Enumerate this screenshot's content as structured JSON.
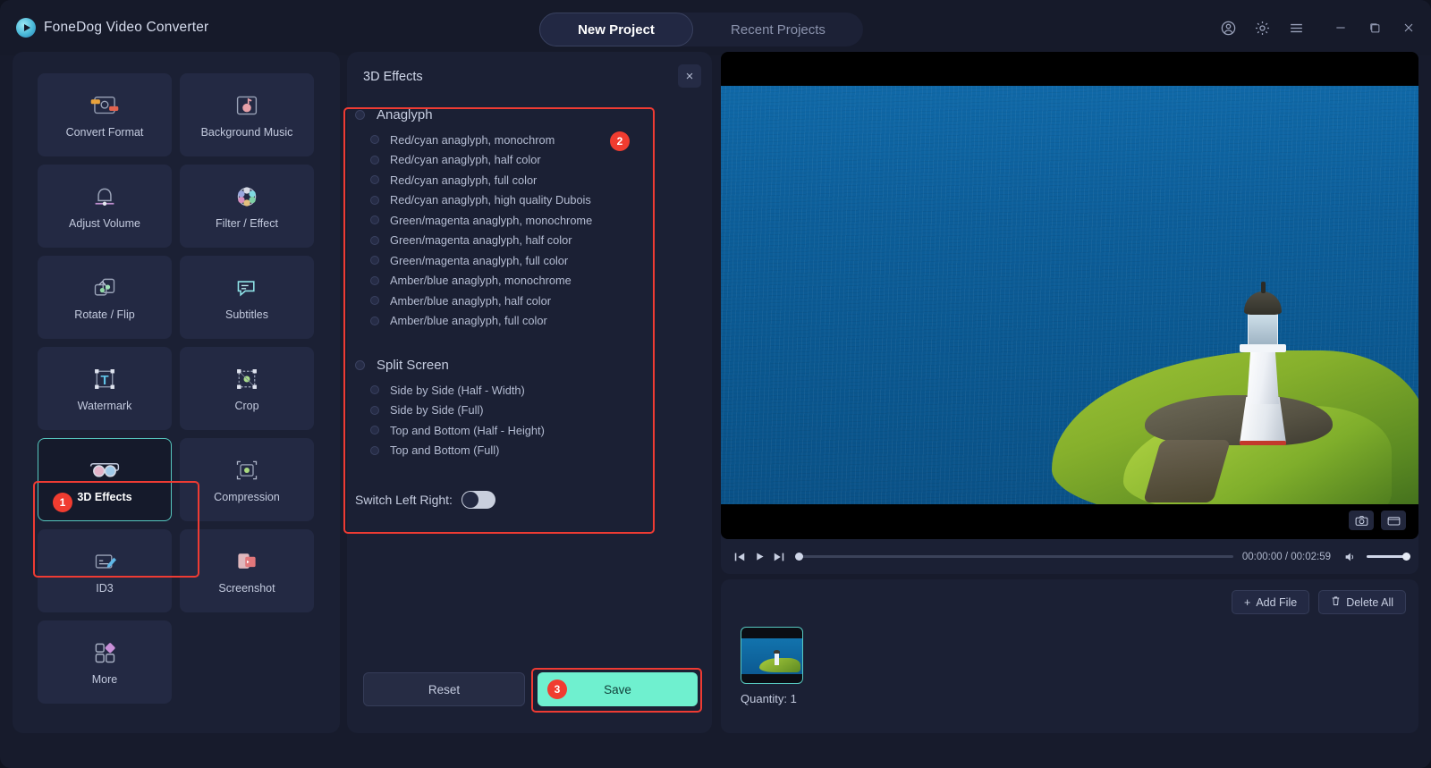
{
  "titlebar": {
    "brand": "FoneDog Video Converter",
    "logo_icon": "play-circle-logo",
    "tabs": [
      {
        "label": "New Project",
        "active": true
      },
      {
        "label": "Recent Projects",
        "active": false
      }
    ],
    "window_icons": [
      "account-icon",
      "gear-icon",
      "menu-icon",
      "minimize-icon",
      "maximize-icon",
      "close-icon"
    ]
  },
  "tools": {
    "items": [
      {
        "label": "Convert Format",
        "icon": "convert-format-icon",
        "selected": false
      },
      {
        "label": "Background Music",
        "icon": "background-music-icon",
        "selected": false
      },
      {
        "label": "Adjust Volume",
        "icon": "adjust-volume-icon",
        "selected": false
      },
      {
        "label": "Filter / Effect",
        "icon": "filter-effect-icon",
        "selected": false
      },
      {
        "label": "Rotate / Flip",
        "icon": "rotate-flip-icon",
        "selected": false
      },
      {
        "label": "Subtitles",
        "icon": "subtitles-icon",
        "selected": false
      },
      {
        "label": "Watermark",
        "icon": "watermark-icon",
        "selected": false
      },
      {
        "label": "Crop",
        "icon": "crop-icon",
        "selected": false
      },
      {
        "label": "3D Effects",
        "icon": "3d-glasses-icon",
        "selected": true
      },
      {
        "label": "Compression",
        "icon": "compression-icon",
        "selected": false
      },
      {
        "label": "ID3",
        "icon": "id3-edit-icon",
        "selected": false
      },
      {
        "label": "Screenshot",
        "icon": "screenshot-icon",
        "selected": false
      },
      {
        "label": "More",
        "icon": "more-grid-icon",
        "selected": false
      }
    ]
  },
  "effects": {
    "title": "3D Effects",
    "close_label": "×",
    "anaglyph": {
      "group_label": "Anaglyph",
      "options": [
        "Red/cyan anaglyph, monochrom",
        "Red/cyan anaglyph, half color",
        "Red/cyan anaglyph, full color",
        "Red/cyan anaglyph, high quality Dubois",
        "Green/magenta anaglyph, monochrome",
        "Green/magenta anaglyph, half color",
        "Green/magenta anaglyph, full color",
        "Amber/blue anaglyph, monochrome",
        "Amber/blue anaglyph, half color",
        "Amber/blue anaglyph, full color"
      ]
    },
    "split_screen": {
      "group_label": "Split Screen",
      "options": [
        "Side by Side (Half - Width)",
        "Side by Side (Full)",
        "Top and Bottom (Half - Height)",
        "Top and Bottom (Full)"
      ]
    },
    "switch_left_right": {
      "label": "Switch Left Right:",
      "value": "off"
    },
    "reset_label": "Reset",
    "save_label": "Save"
  },
  "annotations": {
    "step1": "1",
    "step2": "2",
    "step3": "3",
    "box_color": "#ee3b33"
  },
  "preview": {
    "snapshot_icon": "camera-icon",
    "gif_icon": "gif-capture-icon",
    "controls": {
      "prev_icon": "skip-previous-icon",
      "play_icon": "play-icon",
      "next_icon": "skip-next-icon",
      "volume_icon": "volume-icon"
    },
    "time": "00:00:00 / 00:02:59"
  },
  "files": {
    "add_label": "Add File",
    "add_icon": "plus-icon",
    "delete_label": "Delete All",
    "delete_icon": "trash-icon",
    "quantity": "Quantity: 1"
  },
  "colors": {
    "accent_teal": "#6ff0cf",
    "selection_border": "#57c8c0",
    "annotation_red": "#ee3b33",
    "panel_bg": "#1b2034",
    "app_bg": "#171b2c"
  }
}
